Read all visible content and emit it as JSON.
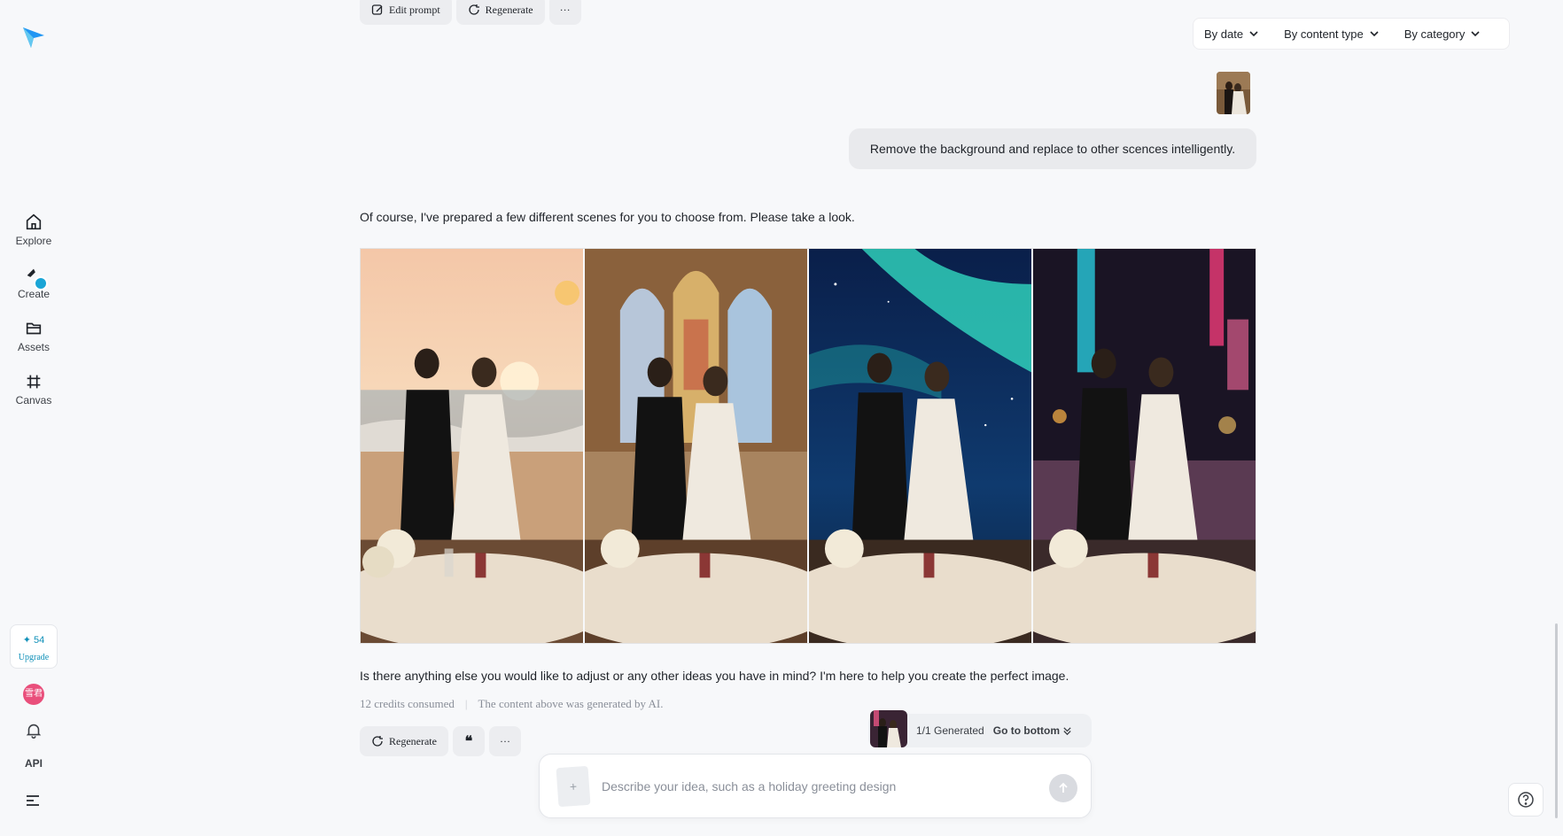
{
  "sidebar": {
    "items": [
      {
        "label": "Explore",
        "icon": "home-icon"
      },
      {
        "label": "Create",
        "icon": "create-icon"
      },
      {
        "label": "Assets",
        "icon": "folder-icon"
      },
      {
        "label": "Canvas",
        "icon": "canvas-icon"
      }
    ],
    "credits_count": "✦ 54",
    "upgrade_label": "Upgrade",
    "avatar_text": "雪君",
    "api_label": "API"
  },
  "filters": {
    "by_date": "By date",
    "by_content_type": "By content type",
    "by_category": "By category"
  },
  "top_actions": {
    "edit_prompt": "Edit prompt",
    "regenerate": "Regenerate",
    "more": "···"
  },
  "chat": {
    "user_message": "Remove the background and replace to other scences intelligently.",
    "ai_intro": "Of course, I've prepared a few different scenes for you to choose from. Please take a look.",
    "images": [
      {
        "scene": "beach-sunset"
      },
      {
        "scene": "church"
      },
      {
        "scene": "aurora"
      },
      {
        "scene": "city-night"
      }
    ],
    "ai_outro": "Is there anything else you would like to adjust or any other ideas you have in mind? I'm here to help you create the perfect image.",
    "credits_consumed": "12 credits consumed",
    "separator": "|",
    "disclaimer": "The content above was generated by AI."
  },
  "bottom_actions": {
    "regenerate": "Regenerate",
    "quote": "❝",
    "more": "···"
  },
  "generated": {
    "status": "1/1  Generated",
    "goto": "Go to bottom"
  },
  "composer": {
    "placeholder": "Describe your idea, such as a holiday greeting design",
    "attach": "+"
  },
  "colors": {
    "accent": "#0e8fb8",
    "bubble": "#e9eaed",
    "avatar": "#e94f7b"
  }
}
